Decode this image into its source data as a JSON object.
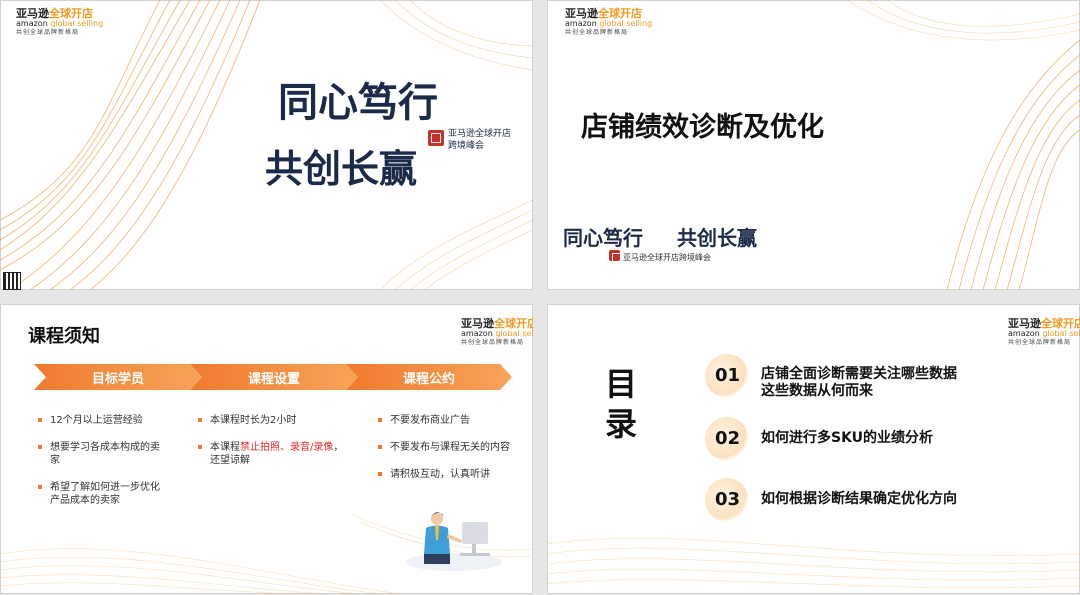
{
  "brand": {
    "logo_cn_1": "亚马逊",
    "logo_cn_2": "全球开店",
    "logo_en_1": "amazon",
    "logo_en_2": "global selling",
    "logo_slogan": "共创全球品牌新格局",
    "calligraphy_line1": "同心笃行",
    "calligraphy_line2": "共创长赢",
    "summit_line1": "亚马逊全球开店",
    "summit_line2": "跨境峰会",
    "summit_full": "亚马逊全球开店跨境峰会"
  },
  "colors": {
    "accent": "#f07a2e",
    "accent_light": "#f6a45a",
    "navy": "#1c2a4a",
    "seal_red": "#c8312a",
    "warning_red": "#e22a2a"
  },
  "slide2": {
    "title": "店铺绩效诊断及优化"
  },
  "slide3": {
    "title": "课程须知",
    "headers": [
      "目标学员",
      "课程设置",
      "课程公约"
    ],
    "col1": [
      "12个月以上运营经验",
      "想要学习各成本构成的卖家",
      "希望了解如何进一步优化产品成本的卖家"
    ],
    "col2_item1": "本课程时长为2小时",
    "col2_item2_pre": "本课程",
    "col2_item2_red": "禁止拍照、录音/录像",
    "col2_item2_post": "，还望谅解",
    "col3": [
      "不要发布商业广告",
      "不要发布与课程无关的内容",
      "请积极互动，认真听讲"
    ]
  },
  "slide4": {
    "label_line1": "目",
    "label_line2": "录",
    "items": [
      {
        "num": "01",
        "line1": "店铺全面诊断需要关注哪些数据",
        "line2": "这些数据从何而来"
      },
      {
        "num": "02",
        "line1": "如何进行多SKU的业绩分析",
        "line2": ""
      },
      {
        "num": "03",
        "line1": "如何根据诊断结果确定优化方向",
        "line2": ""
      }
    ]
  }
}
